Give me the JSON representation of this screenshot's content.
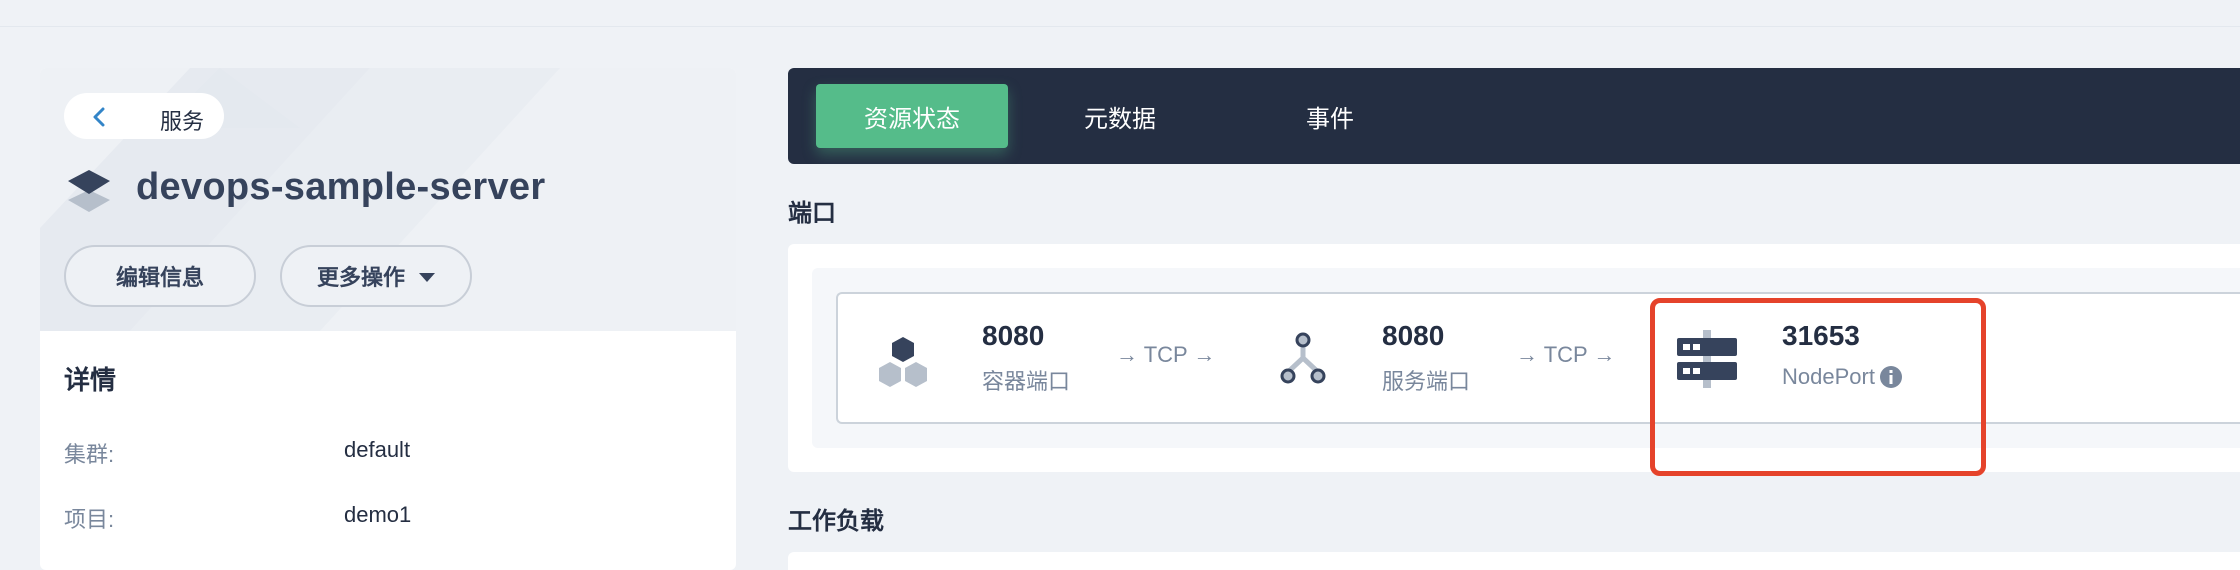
{
  "back": {
    "label": "服务"
  },
  "service": {
    "name": "devops-sample-server"
  },
  "actions": {
    "edit_label": "编辑信息",
    "more_label": "更多操作"
  },
  "details": {
    "title": "详情",
    "rows": [
      {
        "label": "集群:",
        "value": "default"
      },
      {
        "label": "项目:",
        "value": "demo1"
      }
    ]
  },
  "tabs": [
    {
      "label": "资源状态",
      "active": true
    },
    {
      "label": "元数据",
      "active": false
    },
    {
      "label": "事件",
      "active": false
    }
  ],
  "ports_section": {
    "title": "端口"
  },
  "ports": {
    "container": {
      "port": "8080",
      "label": "容器端口"
    },
    "arrow1": "→ TCP →",
    "service": {
      "port": "8080",
      "label": "服务端口"
    },
    "arrow2": "→ TCP →",
    "node": {
      "port": "31653",
      "label": "NodePort"
    }
  },
  "workloads_section": {
    "title": "工作负载"
  },
  "colors": {
    "accent": "#55bc8a",
    "dark": "#242e42",
    "highlight": "#e5432b",
    "muted": "#79879c"
  },
  "icons": [
    "chevron-left-icon",
    "service-layers-icon",
    "caret-down-icon",
    "container-hex-icon",
    "service-branch-icon",
    "node-server-icon",
    "info-icon"
  ]
}
